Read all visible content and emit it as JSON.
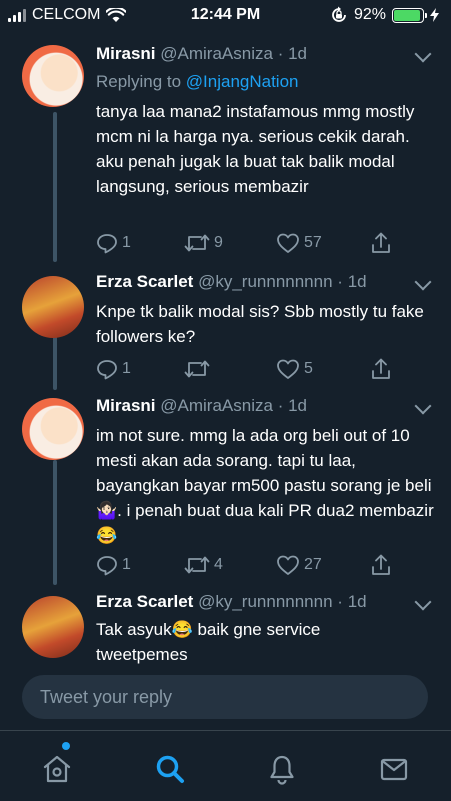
{
  "status_bar": {
    "carrier": "CELCOM",
    "time": "12:44 PM",
    "battery_percent": "92%",
    "battery_level": 0.92,
    "battery_color": "#4cd964"
  },
  "tweets": [
    {
      "name": "Mirasni",
      "handle": "@AmiraAsniza",
      "separator": "·",
      "ago": "1d",
      "replying_prefix": "Replying to ",
      "replying_to": "@InjangNation",
      "text": "tanya laa mana2 instafamous mmg mostly mcm ni la harga nya. serious cekik darah. aku penah jugak la buat tak balik modal langsung, serious membazir",
      "replies": "1",
      "retweets": "9",
      "likes": "57"
    },
    {
      "name": "Erza Scarlet",
      "handle": "@ky_runnnnnnnn",
      "separator": "·",
      "ago": "1d",
      "text": "Knpe tk balik modal sis?  Sbb mostly tu fake followers ke?",
      "replies": "1",
      "retweets": "",
      "likes": "5"
    },
    {
      "name": "Mirasni",
      "handle": "@AmiraAsniza",
      "separator": "·",
      "ago": "1d",
      "text": "im not sure. mmg la ada org beli out of 10 mesti akan ada sorang. tapi tu laa, bayangkan bayar rm500 pastu sorang je beli 🤷🏻‍♀️. i penah buat dua kali PR dua2 membazir 😂",
      "replies": "1",
      "retweets": "4",
      "likes": "27"
    },
    {
      "name": "Erza Scarlet",
      "handle": "@ky_runnnnnnnn",
      "separator": "·",
      "ago": "1d",
      "text": "Tak asyuk😂 baik gne service tweetpemes"
    }
  ],
  "reply_box": {
    "placeholder": "Tweet your reply"
  },
  "tabs": [
    {
      "icon": "home-icon",
      "active": false
    },
    {
      "icon": "search-icon",
      "active": true
    },
    {
      "icon": "bell-icon",
      "active": false
    },
    {
      "icon": "mail-icon",
      "active": false
    }
  ],
  "colors": {
    "background": "#15202b",
    "accent": "#1da1f2",
    "muted": "#8899a6"
  }
}
